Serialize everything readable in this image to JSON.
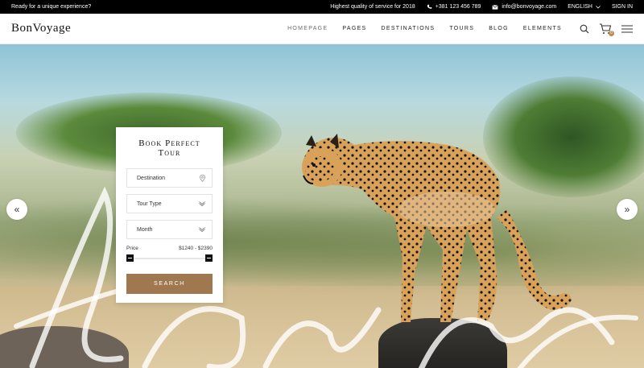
{
  "topbar": {
    "tagline": "Ready for a unique experience?",
    "quality": "Highest quality of service for 2018",
    "phone": "+381 123 456 789",
    "email": "info@bonvoyage.com",
    "language": "ENGLISH",
    "signin": "SIGN IN"
  },
  "header": {
    "logo": "BonVoyage",
    "nav": [
      "HOMEPAGE",
      "PAGES",
      "DESTINATIONS",
      "TOURS",
      "BLOG",
      "ELEMENTS"
    ],
    "cart_count": "0"
  },
  "hero": {
    "prev_arrow": "«",
    "next_arrow": "»"
  },
  "booking": {
    "title": "Book Perfect Tour",
    "destination": "Destination",
    "tour_type": "Tour Type",
    "month": "Month",
    "price_label": "Price",
    "price_range": "$1240 - $2390",
    "search_label": "SEARCH"
  },
  "colors": {
    "accent": "#a07850",
    "badge": "#b88a55",
    "topbar": "#000000"
  },
  "icons": {
    "phone": "phone-icon",
    "email": "envelope-icon",
    "chevron": "chevron-down-icon",
    "search": "search-icon",
    "cart": "cart-icon",
    "menu": "hamburger-menu-icon",
    "location": "location-pin-icon"
  }
}
